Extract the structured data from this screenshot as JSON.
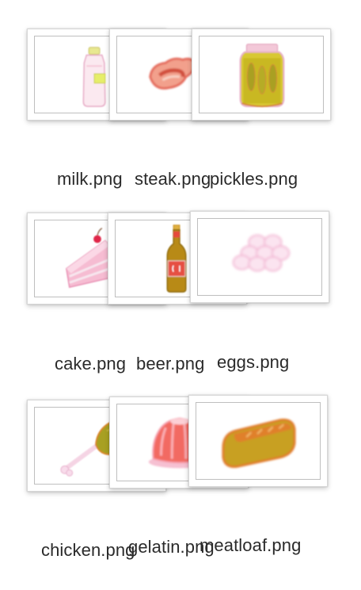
{
  "files": [
    {
      "name": "milk.png",
      "icon": "milk-bottle-icon"
    },
    {
      "name": "steak.png",
      "icon": "steak-icon"
    },
    {
      "name": "pickles.png",
      "icon": "pickle-jar-icon"
    },
    {
      "name": "cake.png",
      "icon": "cake-slice-icon"
    },
    {
      "name": "beer.png",
      "icon": "beer-bottle-icon"
    },
    {
      "name": "eggs.png",
      "icon": "eggs-icon"
    },
    {
      "name": "chicken.png",
      "icon": "chicken-leg-icon"
    },
    {
      "name": "gelatin.png",
      "icon": "gelatin-icon"
    },
    {
      "name": "meatloaf.png",
      "icon": "meatloaf-icon"
    }
  ],
  "colors": {
    "background": "#ffffff",
    "label_text": "#2a2a2a",
    "thumb_border": "#bfbfbf"
  }
}
